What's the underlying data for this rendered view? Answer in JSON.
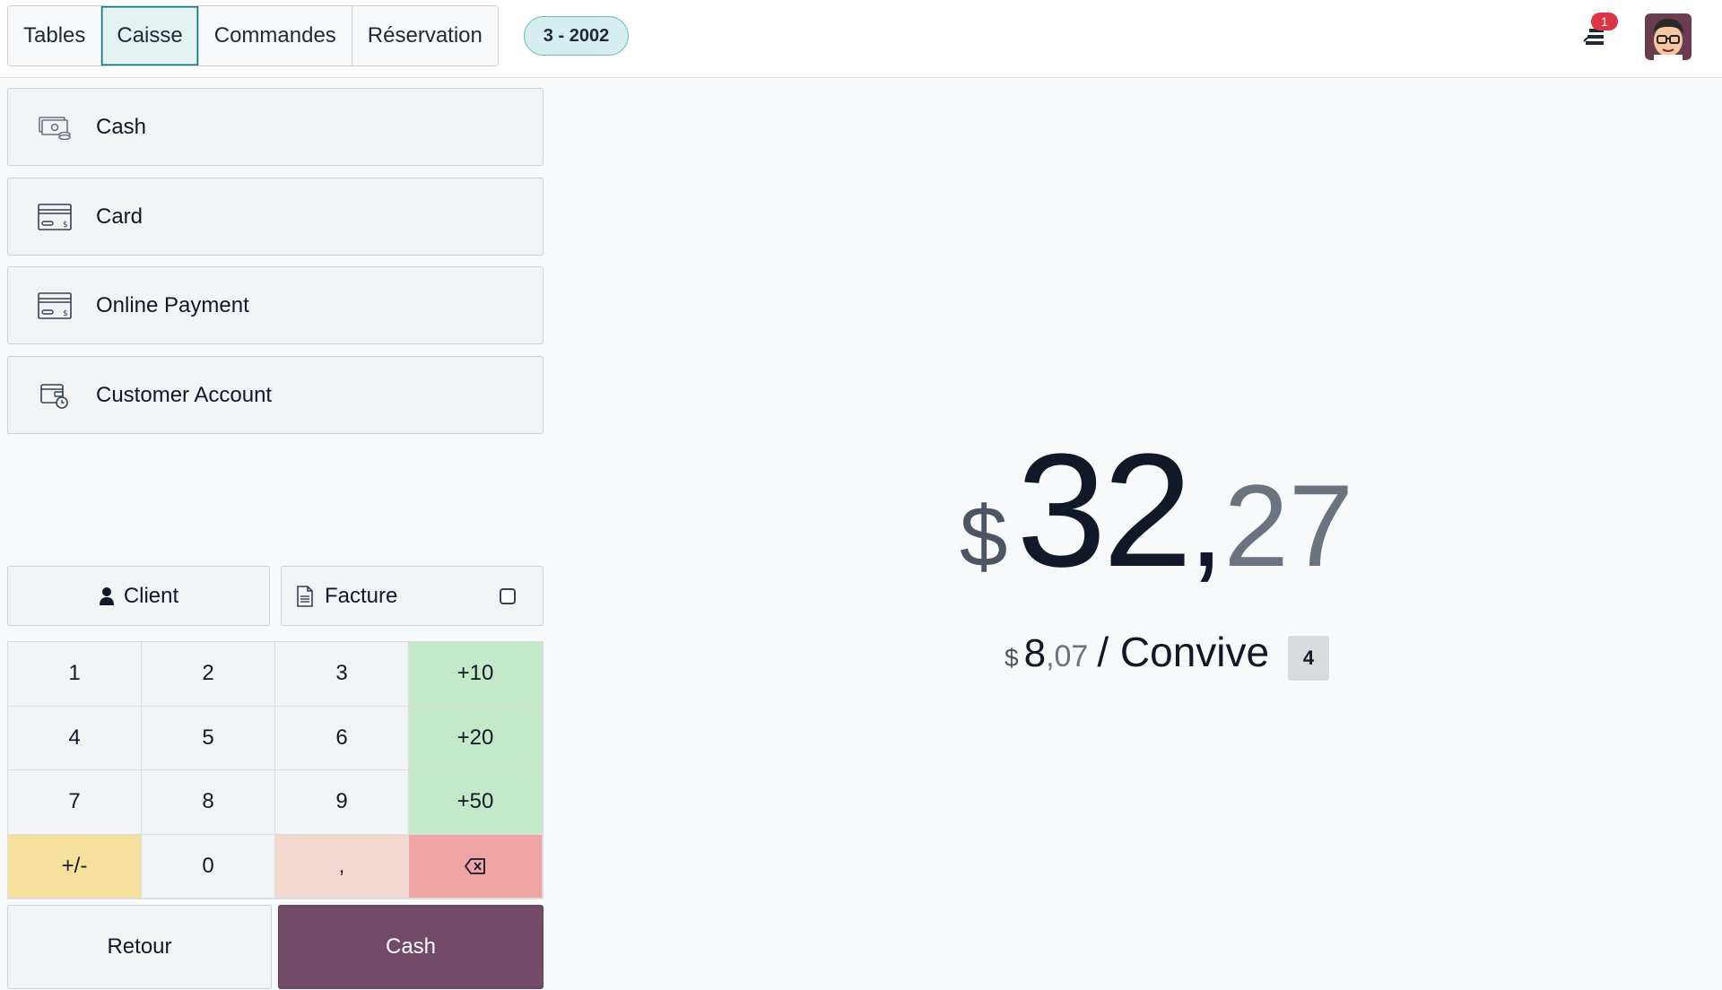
{
  "header": {
    "tabs": [
      {
        "label": "Tables",
        "active": false
      },
      {
        "label": "Caisse",
        "active": true
      },
      {
        "label": "Commandes",
        "active": false
      },
      {
        "label": "Réservation",
        "active": false
      }
    ],
    "order_pill": "3 - 2002",
    "notification_count": "1",
    "avatar_icon": "user-avatar-icon"
  },
  "payment_methods": [
    {
      "label": "Cash",
      "icon": "cash-icon"
    },
    {
      "label": "Card",
      "icon": "card-icon"
    },
    {
      "label": "Online Payment",
      "icon": "card-icon"
    },
    {
      "label": "Customer Account",
      "icon": "customer-account-icon"
    }
  ],
  "actions": {
    "client_label": "Client",
    "facture_label": "Facture",
    "facture_checked": false
  },
  "numpad": {
    "keys": [
      "1",
      "2",
      "3",
      "+10",
      "4",
      "5",
      "6",
      "+20",
      "7",
      "8",
      "9",
      "+50",
      "+/-",
      "0",
      ",",
      ""
    ]
  },
  "footer": {
    "retour_label": "Retour",
    "validate_label": "Cash"
  },
  "total": {
    "currency": "$",
    "integer": "32",
    "separator": ",",
    "decimal": "27"
  },
  "per_guest": {
    "currency": "$",
    "integer": "8",
    "separator": ",",
    "decimal": "07",
    "label": "/ Convive",
    "guests": "4"
  },
  "colors": {
    "accent": "#017e84",
    "primary": "#714b67",
    "green": "#c4e9c8",
    "yellow": "#f5e19b",
    "red": "#f0a5a5"
  }
}
